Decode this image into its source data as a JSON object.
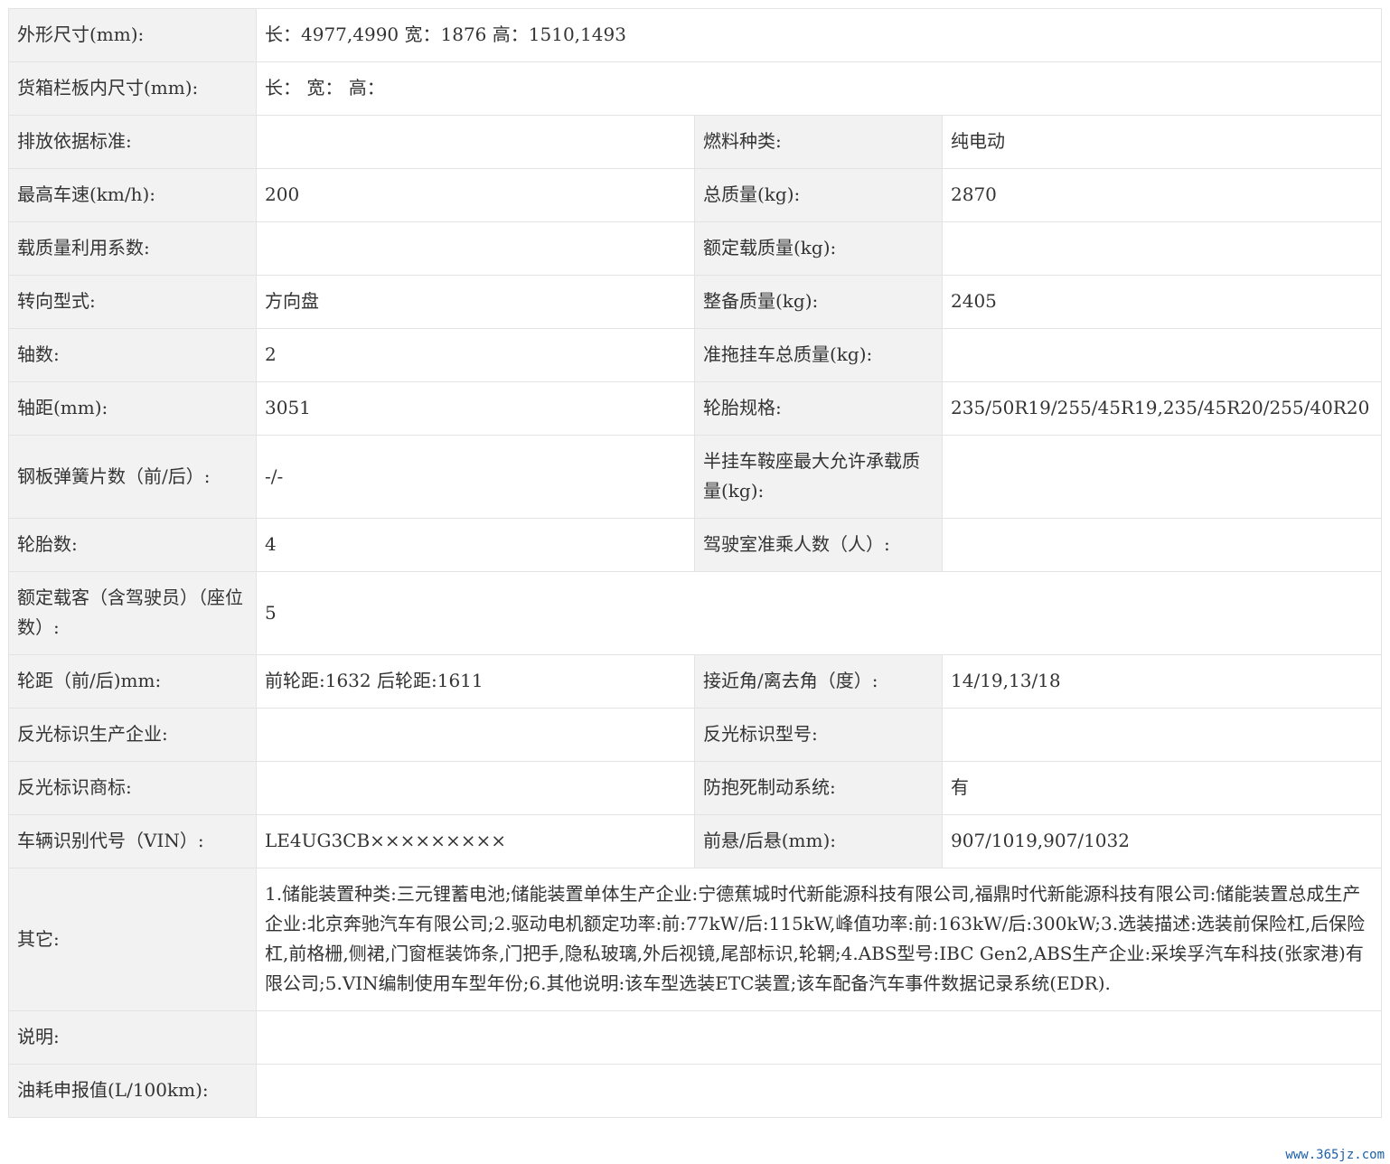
{
  "rows": [
    {
      "l1": "外形尺寸(mm):",
      "v1": "长：4977,4990 宽：1876 高：1510,1493"
    },
    {
      "l1": "货箱栏板内尺寸(mm):",
      "v1": "长：  宽：  高："
    },
    {
      "l1": "排放依据标准:",
      "v1": "",
      "l2": "燃料种类:",
      "v2": "纯电动"
    },
    {
      "l1": "最高车速(km/h):",
      "v1": "200",
      "l2": "总质量(kg):",
      "v2": "2870"
    },
    {
      "l1": "载质量利用系数:",
      "v1": "",
      "l2": "额定载质量(kg):",
      "v2": ""
    },
    {
      "l1": "转向型式:",
      "v1": "方向盘",
      "l2": "整备质量(kg):",
      "v2": "2405"
    },
    {
      "l1": "轴数:",
      "v1": "2",
      "l2": "准拖挂车总质量(kg):",
      "v2": ""
    },
    {
      "l1": "轴距(mm):",
      "v1": "3051",
      "l2": "轮胎规格:",
      "v2": "235/50R19/255/45R19,235/45R20/255/40R20"
    },
    {
      "l1": "钢板弹簧片数（前/后）:",
      "v1": "-/-",
      "l2": "半挂车鞍座最大允许承载质量(kg):",
      "v2": ""
    },
    {
      "l1": "轮胎数:",
      "v1": "4",
      "l2": "驾驶室准乘人数（人）:",
      "v2": ""
    },
    {
      "l1": "额定载客（含驾驶员）（座位数）:",
      "v1": "5"
    },
    {
      "l1": "轮距（前/后)mm:",
      "v1": "前轮距:1632 后轮距:1611",
      "l2": "接近角/离去角（度）:",
      "v2": "14/19,13/18"
    },
    {
      "l1": "反光标识生产企业:",
      "v1": "",
      "l2": "反光标识型号:",
      "v2": ""
    },
    {
      "l1": "反光标识商标:",
      "v1": "",
      "l2": "防抱死制动系统:",
      "v2": "有"
    },
    {
      "l1": "车辆识别代号（VIN）:",
      "v1": "LE4UG3CB×××××××××",
      "l2": "前悬/后悬(mm):",
      "v2": "907/1019,907/1032"
    },
    {
      "l1": "其它:",
      "v1": "1.储能装置种类:三元锂蓄电池;储能装置单体生产企业:宁德蕉城时代新能源科技有限公司,福鼎时代新能源科技有限公司:储能装置总成生产企业:北京奔驰汽车有限公司;2.驱动电机额定功率:前:77kW/后:115kW,峰值功率:前:163kW/后:300kW;3.选装描述:选装前保险杠,后保险杠,前格栅,侧裙,门窗框装饰条,门把手,隐私玻璃,外后视镜,尾部标识,轮辋;4.ABS型号:IBC Gen2,ABS生产企业:采埃孚汽车科技(张家港)有限公司;5.VIN编制使用车型年份;6.其他说明:该车型选装ETC装置;该车配备汽车事件数据记录系统(EDR)."
    },
    {
      "l1": "说明:",
      "v1": ""
    },
    {
      "l1": "油耗申报值(L/100km):",
      "v1": ""
    }
  ],
  "watermark": "www.365jz.com"
}
